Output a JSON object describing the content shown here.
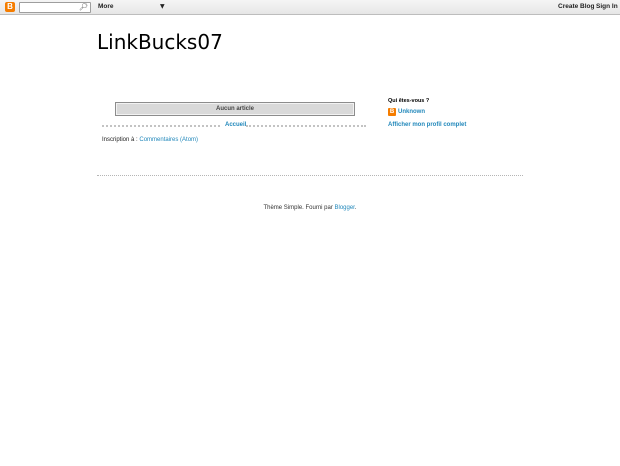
{
  "navbar": {
    "logo_glyph": "B",
    "search": {
      "value": "",
      "placeholder": ""
    },
    "more_label": "More",
    "create_blog_label": "Create Blog",
    "sign_in_label": "Sign In"
  },
  "header": {
    "title": "LinkBucks07"
  },
  "main": {
    "no_posts_label": "Aucun article",
    "home_label": "Accueil",
    "subscribe_prefix": "Inscription à :",
    "subscribe_link": "Commentaires (Atom)"
  },
  "sidebar": {
    "profile_heading": "Qui êtes-vous ?",
    "profile_name": "Unknown",
    "profile_full_link": "Afficher mon profil complet"
  },
  "footer": {
    "attribution_prefix": "Thème Simple. Fourni par ",
    "attribution_link": "Blogger",
    "attribution_suffix": "."
  },
  "colors": {
    "link": "#2288bb",
    "brand": "#f57d00"
  },
  "icons": {
    "logo": "blogger-logo-icon",
    "search": "search-icon",
    "dropdown": "chevron-down-icon"
  }
}
